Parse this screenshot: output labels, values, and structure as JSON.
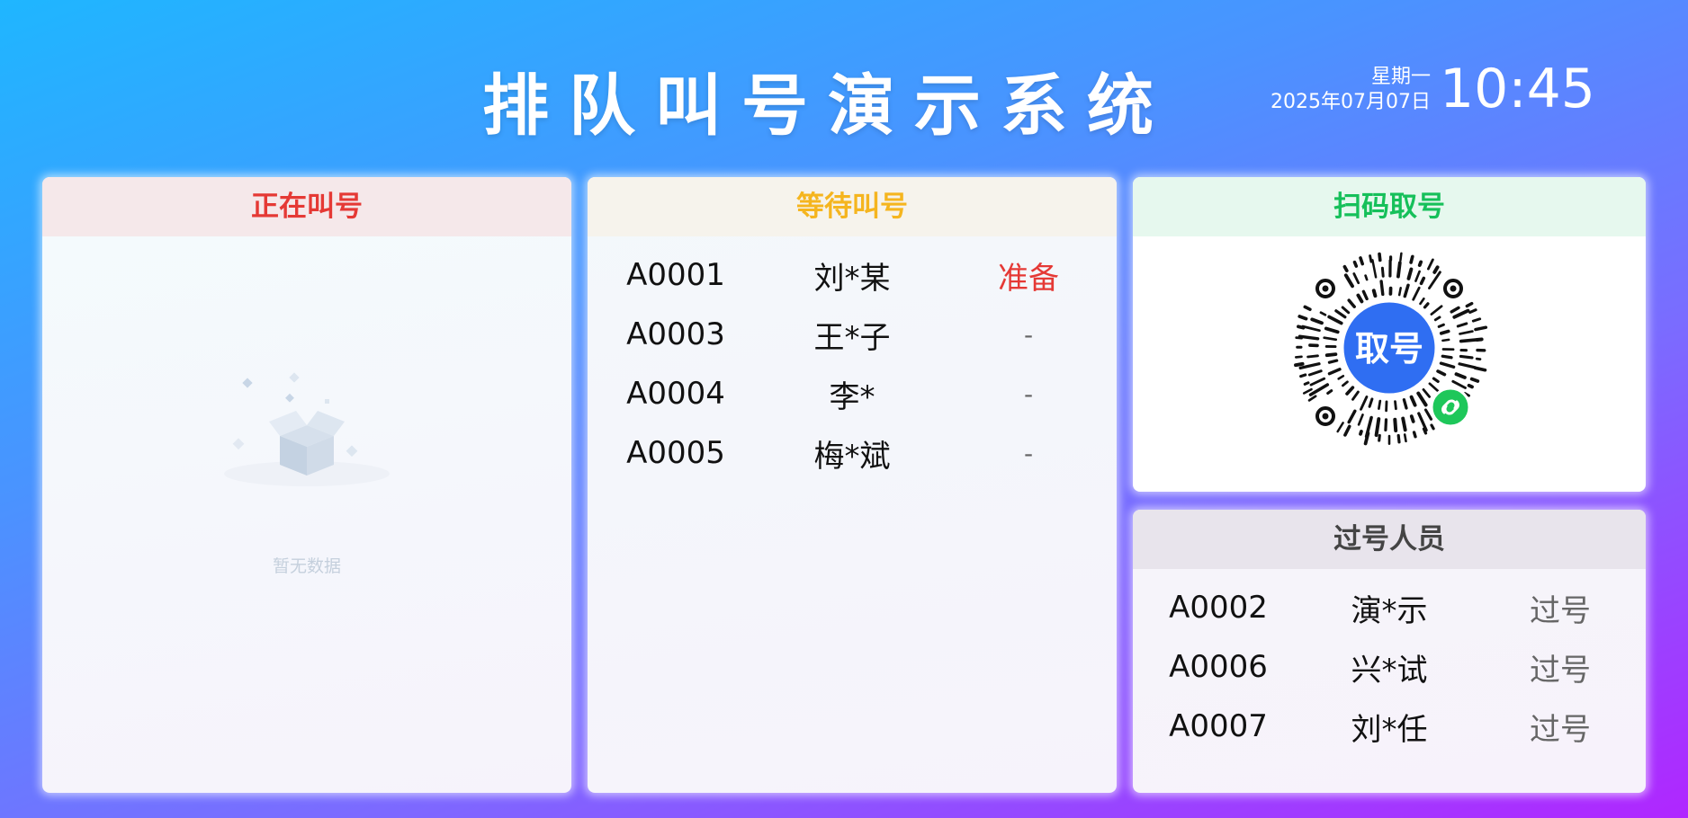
{
  "header": {
    "title": "排队叫号演示系统",
    "weekday": "星期一",
    "date": "2025年07月07日",
    "time": "10:45"
  },
  "calling": {
    "title": "正在叫号",
    "empty_text": "暂无数据"
  },
  "waiting": {
    "title": "等待叫号",
    "rows": [
      {
        "number": "A0001",
        "name": "刘*某",
        "status": "准备"
      },
      {
        "number": "A0003",
        "name": "王*子",
        "status": "-"
      },
      {
        "number": "A0004",
        "name": "李*",
        "status": "-"
      },
      {
        "number": "A0005",
        "name": "梅*斌",
        "status": "-"
      }
    ]
  },
  "scan": {
    "title": "扫码取号",
    "qr_label": "取号",
    "icons": [
      "mini-program-qr-code-icon",
      "link-icon"
    ]
  },
  "passed": {
    "title": "过号人员",
    "rows": [
      {
        "number": "A0002",
        "name": "演*示",
        "status": "过号"
      },
      {
        "number": "A0006",
        "name": "兴*试",
        "status": "过号"
      },
      {
        "number": "A0007",
        "name": "刘*任",
        "status": "过号"
      }
    ]
  },
  "colors": {
    "calling_accent": "#e53935",
    "waiting_accent": "#f5b51f",
    "scan_accent": "#16c05a",
    "qr_center": "#2f6ef2"
  }
}
